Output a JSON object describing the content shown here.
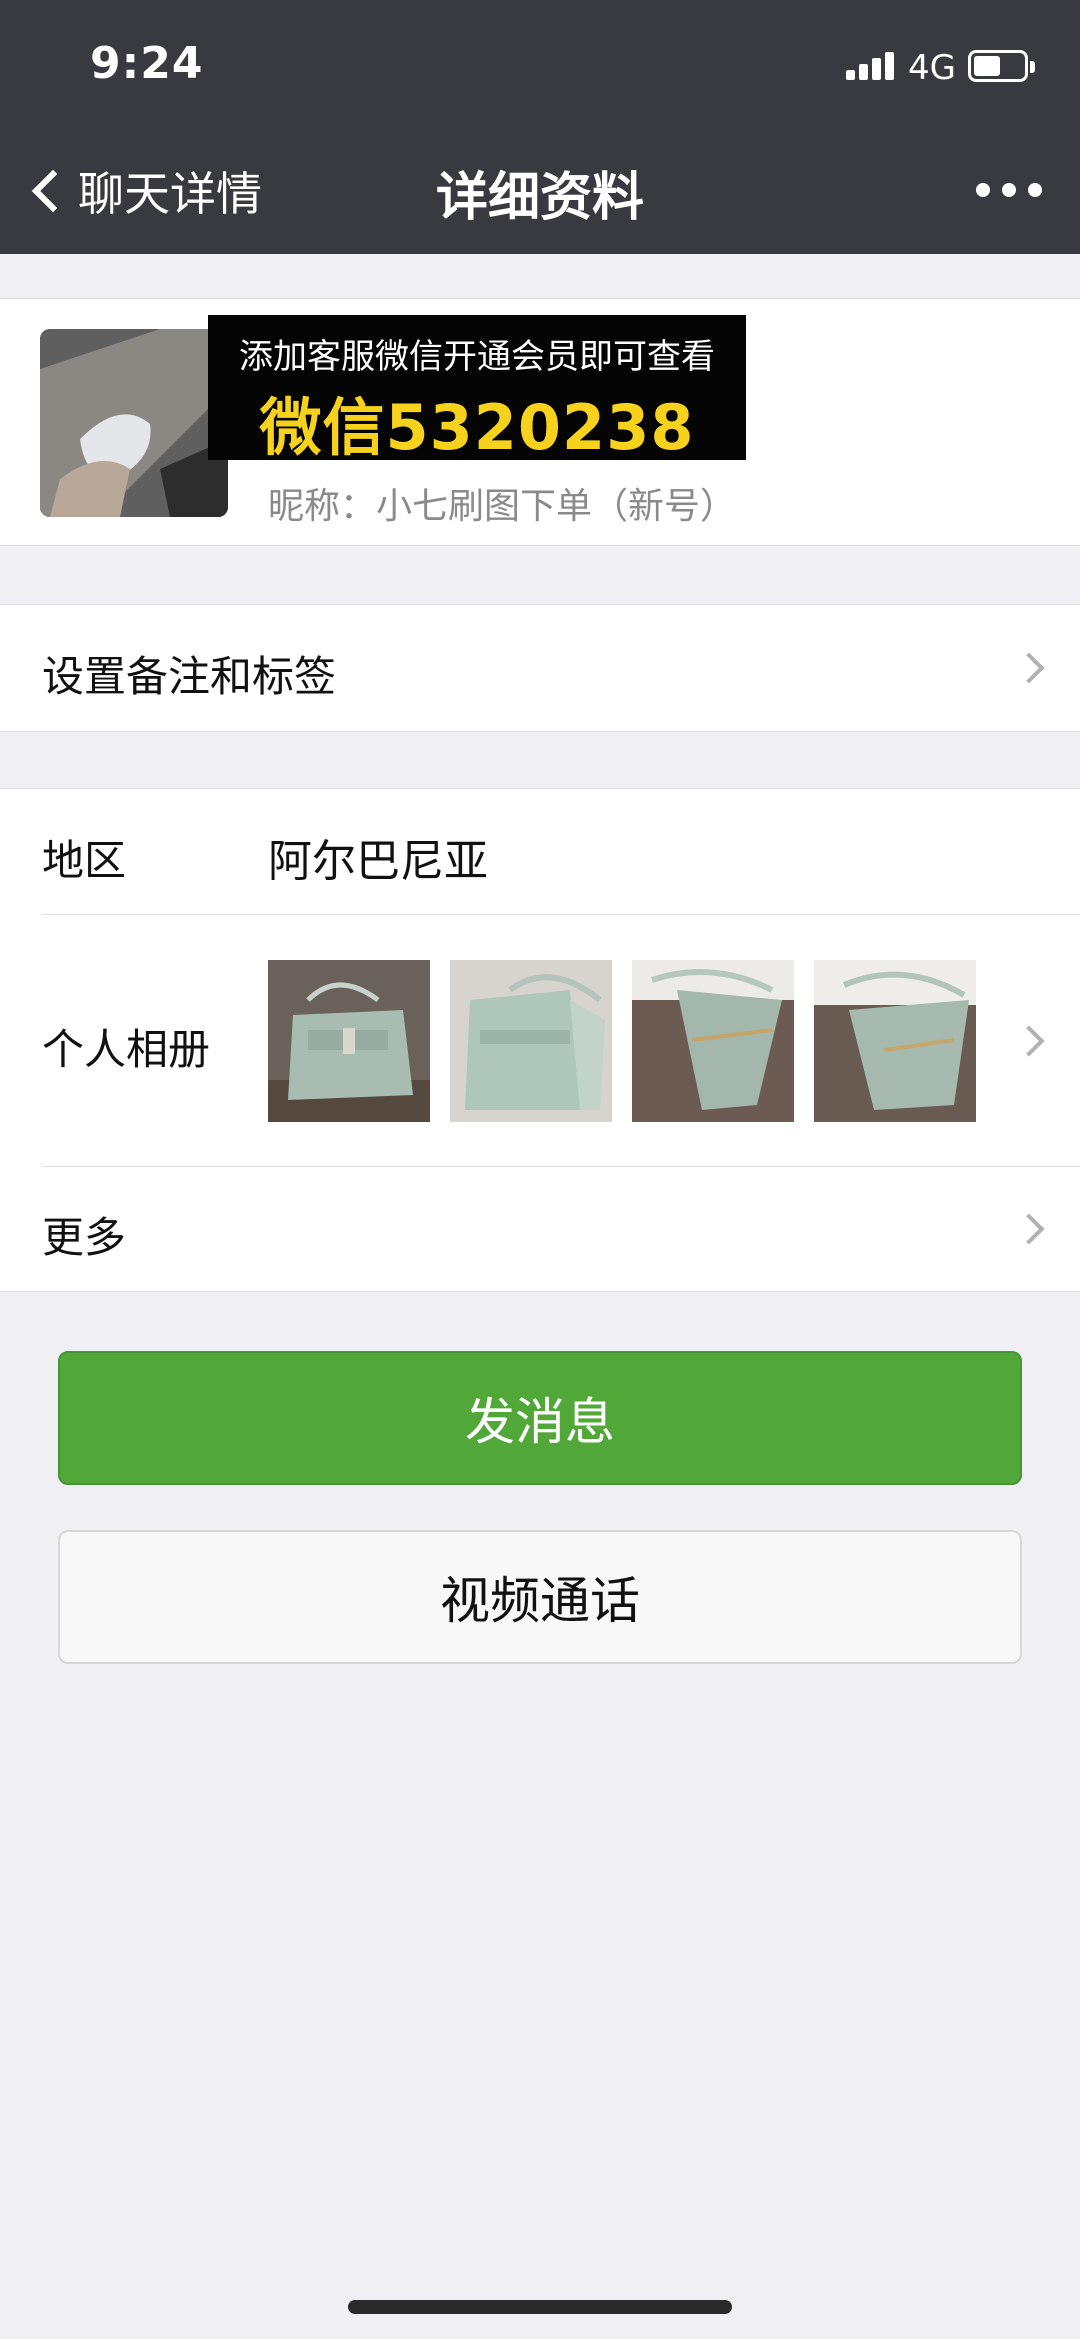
{
  "status_bar": {
    "time": "9:24",
    "network": "4G",
    "battery_level": 0.55
  },
  "nav": {
    "back_label": "聊天详情",
    "title": "详细资料",
    "more_icon": "more-icon"
  },
  "profile": {
    "banner_line1": "添加客服微信开通会员即可查看",
    "banner_line2": "微信5320238",
    "nickname": "昵称：小七刷图下单（新号）"
  },
  "settings_row": {
    "label": "设置备注和标签"
  },
  "details": {
    "region_label": "地区",
    "region_value": "阿尔巴尼亚",
    "album_label": "个人相册",
    "album_photo_count": 4,
    "more_label": "更多"
  },
  "actions": {
    "send_message": "发消息",
    "video_call": "视频通话"
  },
  "colors": {
    "nav_bg": "#393a3f",
    "primary_green": "#51a839",
    "banner_text": "#f7d21d",
    "page_bg": "#efeff4"
  }
}
